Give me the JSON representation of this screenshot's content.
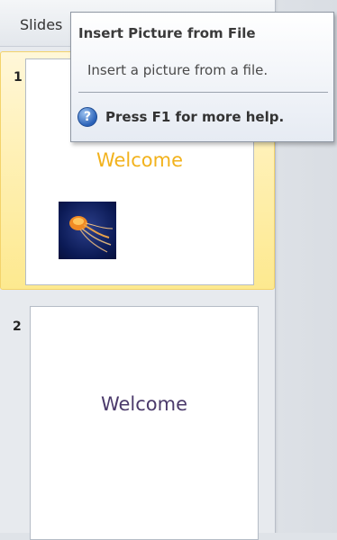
{
  "pane": {
    "tab_label": "Slides"
  },
  "slides": [
    {
      "number": "1",
      "title": "Welcome",
      "title_color": "#f2b21c",
      "image": "jellyfish-picture"
    },
    {
      "number": "2",
      "title": "Welcome",
      "title_color": "#4b3a6b"
    }
  ],
  "tooltip": {
    "title": "Insert Picture from File",
    "description": "Insert a picture from a file.",
    "help_icon": "question-icon",
    "help_text": "Press F1 for more help."
  },
  "colors": {
    "selected_highlight": "#fde98f",
    "tooltip_border": "#8f97a3"
  }
}
